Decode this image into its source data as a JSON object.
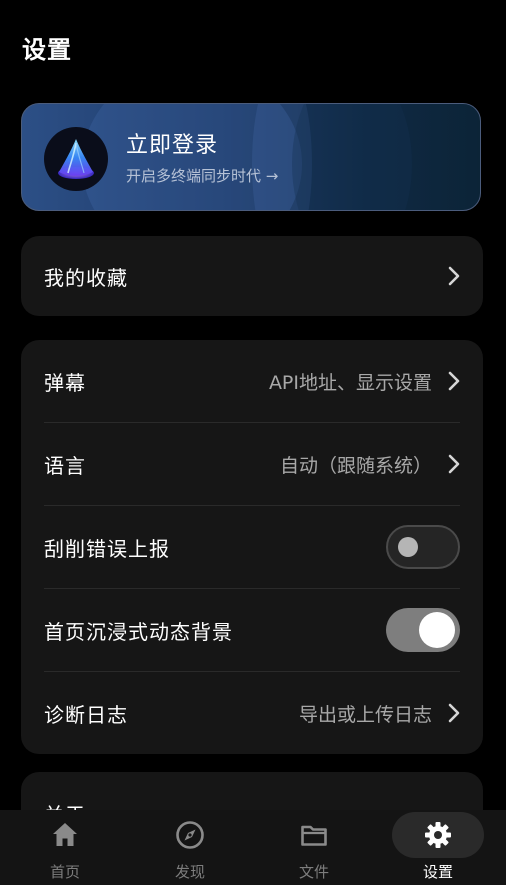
{
  "page": {
    "title": "设置"
  },
  "login": {
    "title": "立即登录",
    "subtitle": "开启多终端同步时代 →"
  },
  "favorites": {
    "label": "我的收藏"
  },
  "settings": {
    "danmaku": {
      "label": "弹幕",
      "value": "API地址、显示设置"
    },
    "language": {
      "label": "语言",
      "value": "自动（跟随系统）"
    },
    "scrape_errors": {
      "label": "刮削错误上报",
      "enabled": false
    },
    "immersive_bg": {
      "label": "首页沉浸式动态背景",
      "enabled": true
    },
    "diagnostics": {
      "label": "诊断日志",
      "value": "导出或上传日志"
    }
  },
  "about": {
    "label": "关于"
  },
  "nav": {
    "items": [
      {
        "label": "首页",
        "icon": "home-icon"
      },
      {
        "label": "发现",
        "icon": "compass-icon"
      },
      {
        "label": "文件",
        "icon": "folder-icon"
      },
      {
        "label": "设置",
        "icon": "gear-icon"
      }
    ],
    "active": "设置"
  },
  "colors": {
    "background": "#000000",
    "card": "#161616",
    "login_accent": "#2c4f86",
    "secondary_text": "#a8a8a8"
  }
}
